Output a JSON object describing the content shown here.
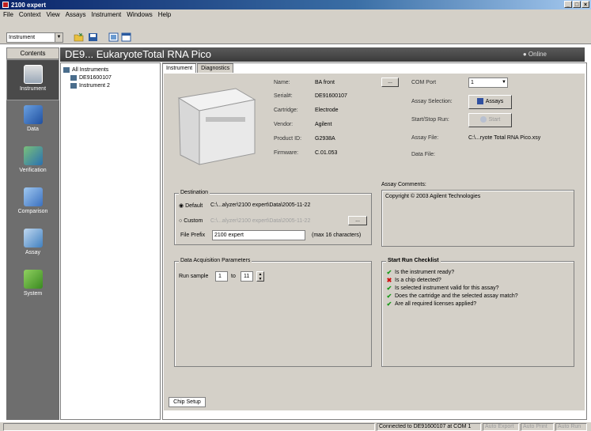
{
  "window": {
    "title": "2100 expert",
    "controls": [
      "_",
      "□",
      "×"
    ]
  },
  "menu": [
    "File",
    "Context",
    "View",
    "Assays",
    "Instrument",
    "Windows",
    "Help"
  ],
  "toolbar": {
    "context_value": "Instrument"
  },
  "sidebar": {
    "heading": "Contents",
    "items": [
      {
        "label": "Instrument",
        "icon": "instrument-icon",
        "active": true
      },
      {
        "label": "Data",
        "icon": "data-icon"
      },
      {
        "label": "Verification",
        "icon": "verification-icon"
      },
      {
        "label": "Comparison",
        "icon": "comparison-icon"
      },
      {
        "label": "Assay",
        "icon": "assay-icon"
      },
      {
        "label": "System",
        "icon": "system-icon"
      }
    ]
  },
  "header": {
    "title": "DE9... EukaryoteTotal RNA Pico",
    "status": "Online"
  },
  "tree": {
    "root": "All Instruments",
    "children": [
      "DE91600107",
      "Instrument 2"
    ]
  },
  "tabs": [
    "Instrument",
    "Diagnostics"
  ],
  "instrument_info": {
    "name_label": "Name:",
    "name": "BA front",
    "serial_label": "Serial#:",
    "serial": "DE91600107",
    "cartridge_label": "Cartridge:",
    "cartridge": "Electrode",
    "vendor_label": "Vendor:",
    "vendor": "Agilent",
    "product_label": "Product ID:",
    "product": "G2938A",
    "firmware_label": "Firmware:",
    "firmware": "C.01.053"
  },
  "browse_button": "...",
  "run_info": {
    "com_label": "COM Port",
    "com_value": "1",
    "assay_sel_label": "Assay Selection:",
    "assays_button": "Assays",
    "startstop_label": "Start/Stop Run:",
    "start_button": "Start",
    "assay_file_label": "Assay File:",
    "assay_file": "C:\\...ryote Total RNA Pico.xsy",
    "data_file_label": "Data File:"
  },
  "destination": {
    "title": "Destination",
    "default_label": "Default",
    "default_path": "C:\\...alyzer\\2100 expert\\Data\\2005-11-22",
    "custom_label": "Custom",
    "custom_path": "C:\\...alyzer\\2100 expert\\Data\\2005-11-22",
    "prefix_label": "File Prefix",
    "prefix_value": "2100 expert",
    "prefix_hint": "(max 16 characters)"
  },
  "assay_comments": {
    "title": "Assay Comments:",
    "text": "Copyright © 2003 Agilent Technologies"
  },
  "acquisition": {
    "title": "Data Acquisition Parameters",
    "run_label": "Run sample",
    "from": "1",
    "to_label": "to",
    "to": "11"
  },
  "checklist": {
    "title": "Start Run Checklist",
    "items": [
      {
        "text": "Is the instrument ready?",
        "ok": true
      },
      {
        "text": "Is a chip detected?",
        "ok": false
      },
      {
        "text": "Is selected instrument valid for this assay?",
        "ok": true
      },
      {
        "text": "Does the cartridge and the selected assay match?",
        "ok": true
      },
      {
        "text": "Are all required licenses applied?",
        "ok": true
      }
    ]
  },
  "bottom_tab": "Chip Setup",
  "status": {
    "connection": "Connected to DE91600107 at COM 1",
    "auto_export": "Auto Export",
    "auto_print": "Auto Print",
    "auto_run": "Auto Run"
  },
  "colors": {
    "ok": "#1a9a1a",
    "bad": "#d01010",
    "sidebar": "#6e6e6e"
  }
}
